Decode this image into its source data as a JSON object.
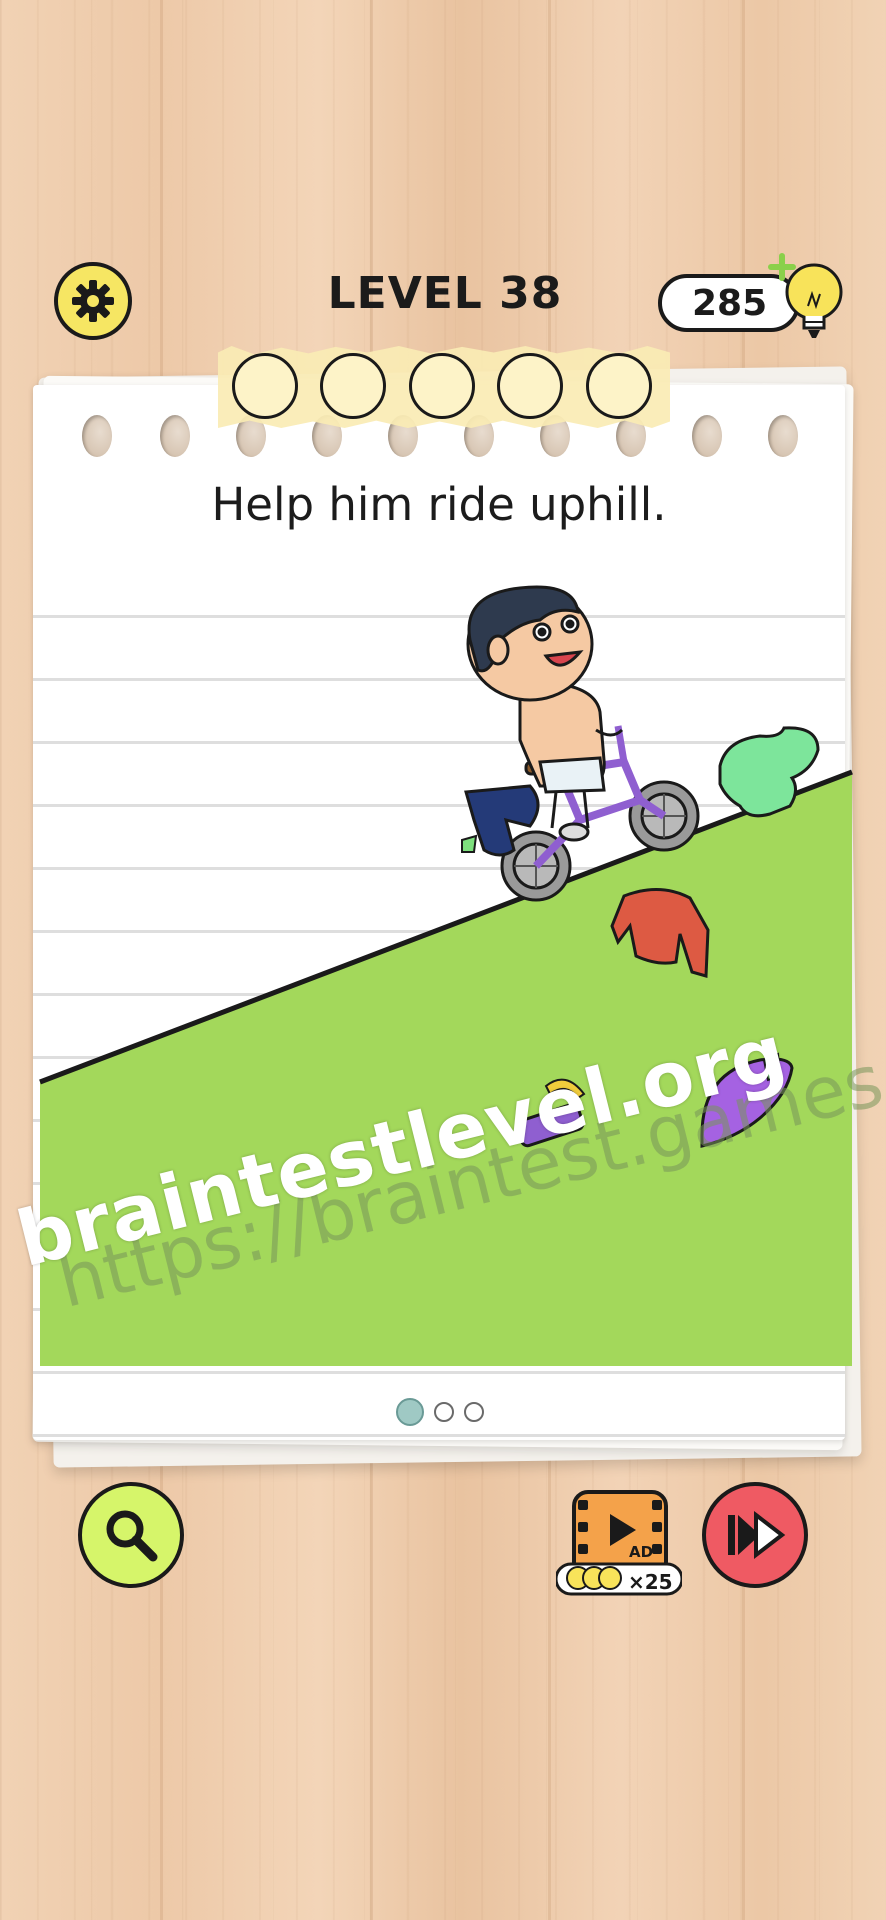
{
  "header": {
    "level_title": "LEVEL 38",
    "hint_count": "285"
  },
  "progress": {
    "answer_slots": 5
  },
  "puzzle": {
    "instruction": "Help him ride uphill."
  },
  "watermarks": {
    "primary": "braintestlevel.org",
    "secondary": "https://braintest.games"
  },
  "pagination": {
    "total": 3,
    "current": 1
  },
  "footer": {
    "ad_label": "AD",
    "ad_reward": "×25"
  },
  "colors": {
    "gear_button": "#f6e663",
    "search_button": "#d6f56a",
    "skip_button": "#ef5a63",
    "hill": "#a3d85b",
    "tape": "#faecb4"
  },
  "icons": [
    "gear-icon",
    "lightbulb-icon",
    "magnifier-icon",
    "video-ad-icon",
    "skip-icon"
  ]
}
